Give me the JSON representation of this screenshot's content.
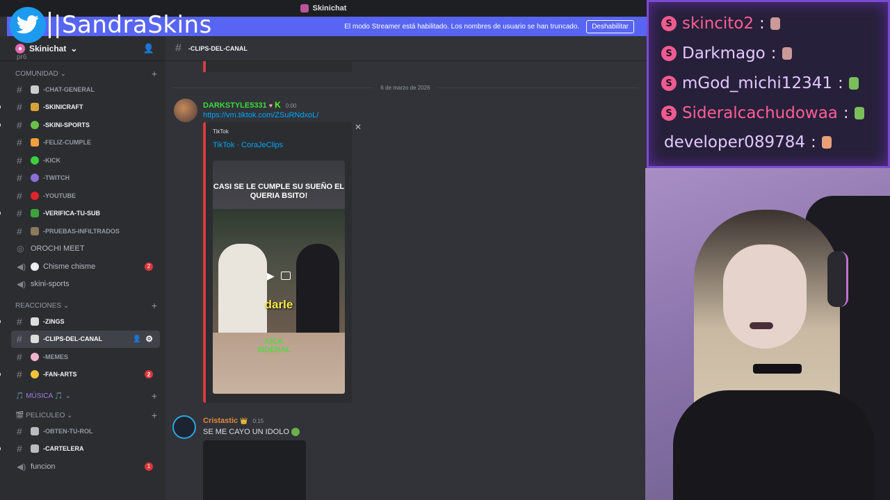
{
  "titlebar": {
    "server_title": "Skinichat"
  },
  "streamer_banner": {
    "message": "El modo Streamer está habilitado. Los nombres de usuario se han truncado.",
    "button_label": "Deshabilitar"
  },
  "brand": {
    "name": "|SandraSkins"
  },
  "sidebar": {
    "server_name": "Skinichat",
    "partial_top_channel": "pr6",
    "categories": [
      {
        "label": "COMUNIDAD"
      },
      {
        "label": "REACCIONES"
      },
      {
        "label": "🎵 MÚSICA 🎵"
      },
      {
        "label": "PELICULEO"
      }
    ],
    "channels": [
      {
        "label": "-CHAT-GENERAL"
      },
      {
        "label": "-SKINICRAFT"
      },
      {
        "label": "-SKINI-SPORTS"
      },
      {
        "label": "-FELIZ-CUMPLE"
      },
      {
        "label": "-KICK"
      },
      {
        "label": "-TWITCH"
      },
      {
        "label": "-YOUTUBE"
      },
      {
        "label": "-VERIFICA-TU-SUB"
      },
      {
        "label": "-PRUEBAS-INFILTRADOS"
      },
      {
        "label": "OROCHI MEET"
      },
      {
        "label": "Chisme chisme",
        "badge": "2"
      },
      {
        "label": "skini-sports"
      },
      {
        "label": "-ZINGS"
      },
      {
        "label": "-CLIPS-DEL-CANAL"
      },
      {
        "label": "-MEMES"
      },
      {
        "label": "-FAN-ARTS",
        "badge": "2"
      },
      {
        "label": "-OBTEN-TU-ROL"
      },
      {
        "label": "-CARTELERA"
      },
      {
        "label": "funcion",
        "badge": "1"
      }
    ]
  },
  "channel_header": {
    "name": "-CLIPS-DEL-CANAL"
  },
  "messages": {
    "date_separator": "6 de marzo de 2026",
    "msg1": {
      "author": "DARKSTYLE5331",
      "time": "0:00",
      "link": "https://vm.tiktok.com/ZSuRNdxoL/",
      "embed": {
        "provider": "TikTok",
        "title": "TikTok · CoraJeClips",
        "caption": "CASI SE LE CUMPLE SU SUEÑO EL QUERIA BSITO!",
        "subtitle": "darle",
        "watermark": "KICK SIDERAL"
      }
    },
    "msg2": {
      "author": "Cristastic",
      "time": "0:15",
      "text": "SE ME CAYO UN IDOLO"
    }
  },
  "stream_chat": {
    "rows": [
      {
        "user": "skincito2",
        "sep": ":"
      },
      {
        "user": "Darkmago",
        "sep": ":"
      },
      {
        "user": "mGod_michi12341",
        "sep": ":"
      },
      {
        "user": "Sideralcachudowaa",
        "sep": ":"
      },
      {
        "user": "developer089784",
        "sep": ":"
      }
    ]
  },
  "colors": {
    "accent": "#5865f2",
    "badge_red": "#da373c",
    "link": "#00a8fc",
    "embed_border": "#d83c3e"
  }
}
